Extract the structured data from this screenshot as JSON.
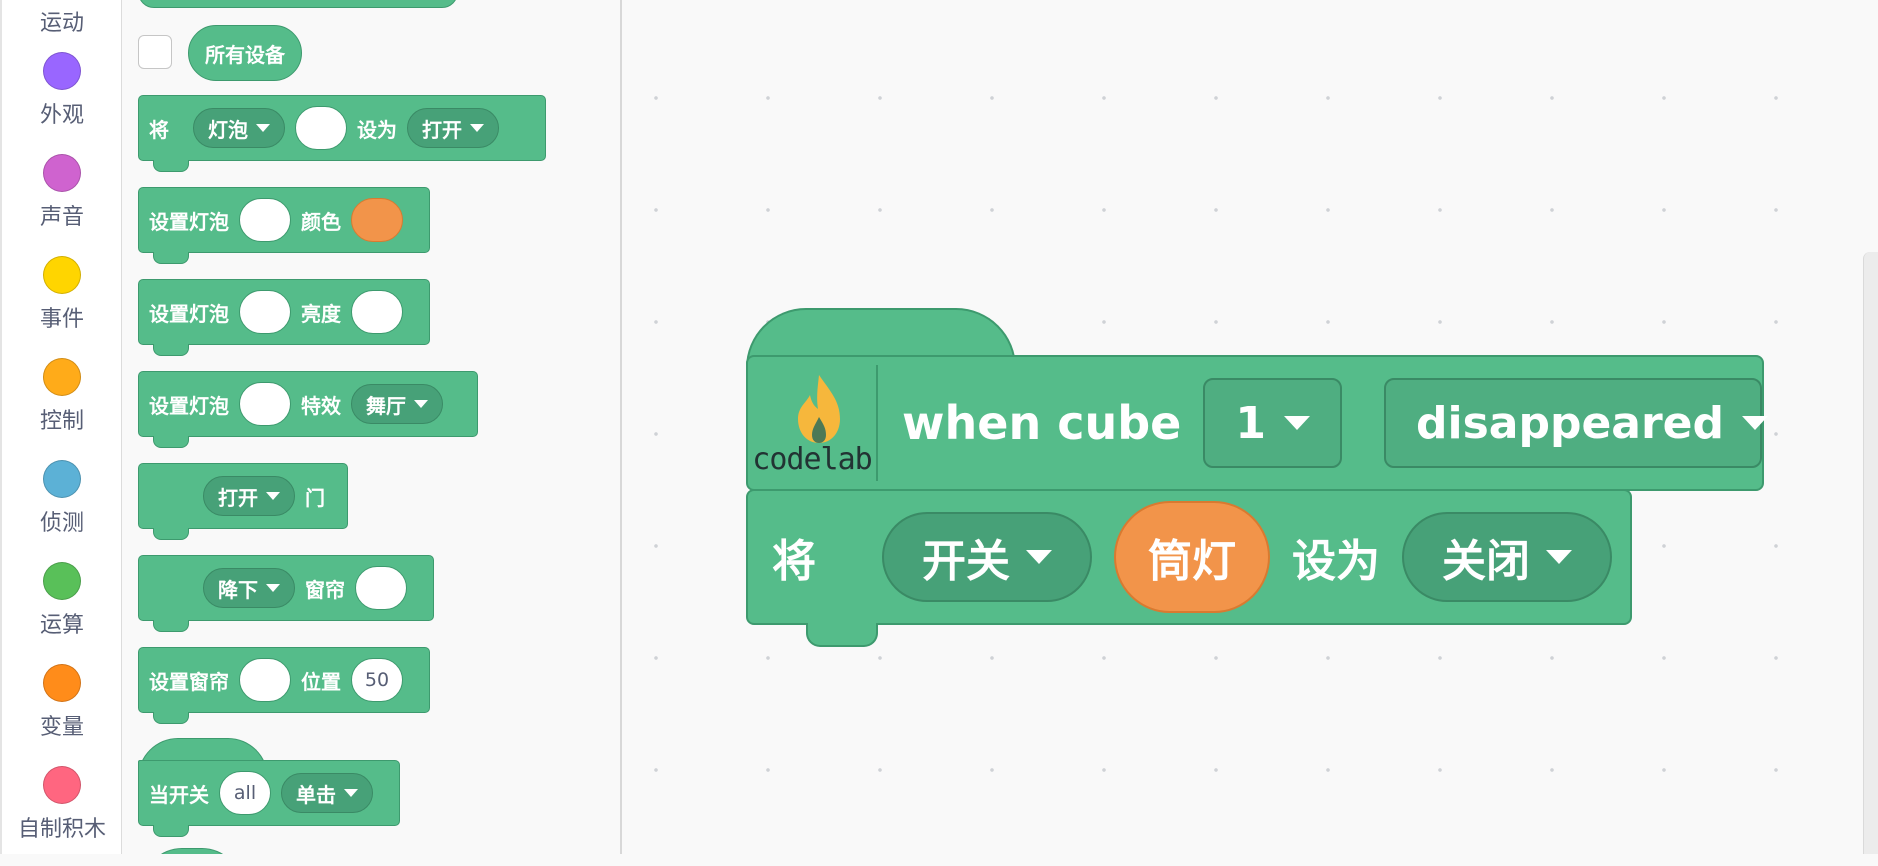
{
  "categories": [
    {
      "label": "运动",
      "color": "#4c97ff"
    },
    {
      "label": "外观",
      "color": "#9966ff"
    },
    {
      "label": "声音",
      "color": "#cf63cf"
    },
    {
      "label": "事件",
      "color": "#ffd500"
    },
    {
      "label": "控制",
      "color": "#ffab19"
    },
    {
      "label": "侦测",
      "color": "#5cb1d6"
    },
    {
      "label": "运算",
      "color": "#59c059"
    },
    {
      "label": "变量",
      "color": "#ff8c1a"
    },
    {
      "label": "自制积木",
      "color": "#ff6680"
    }
  ],
  "flyout": {
    "all_devices": "所有设备",
    "set_bulb_power": {
      "prefix": "将",
      "device": "灯泡",
      "set_as": "设为",
      "state": "打开"
    },
    "set_bulb_color": {
      "label": "设置灯泡",
      "color_label": "颜色"
    },
    "set_bulb_brightness": {
      "label": "设置灯泡",
      "brightness_label": "亮度"
    },
    "set_bulb_effect": {
      "label": "设置灯泡",
      "effect_label": "特效",
      "effect": "舞厅"
    },
    "door": {
      "action": "打开",
      "label": "门"
    },
    "curtain": {
      "action": "降下",
      "label": "窗帘"
    },
    "curtain_position": {
      "label": "设置窗帘",
      "position_label": "位置",
      "value": "50"
    },
    "when_switch": {
      "label": "当开关",
      "target": "all",
      "event": "单击"
    }
  },
  "workspace": {
    "hat_block": {
      "logo_text": "codelab",
      "label": "when cube",
      "cube": "1",
      "event": "disappeared"
    },
    "command_block": {
      "prefix": "将",
      "device": "开关",
      "target": "筒灯",
      "set_as": "设为",
      "state": "关闭"
    }
  },
  "colors": {
    "block_green": "#55bc8a",
    "block_border": "#3d9a6e",
    "accent_orange": "#f2944a"
  }
}
